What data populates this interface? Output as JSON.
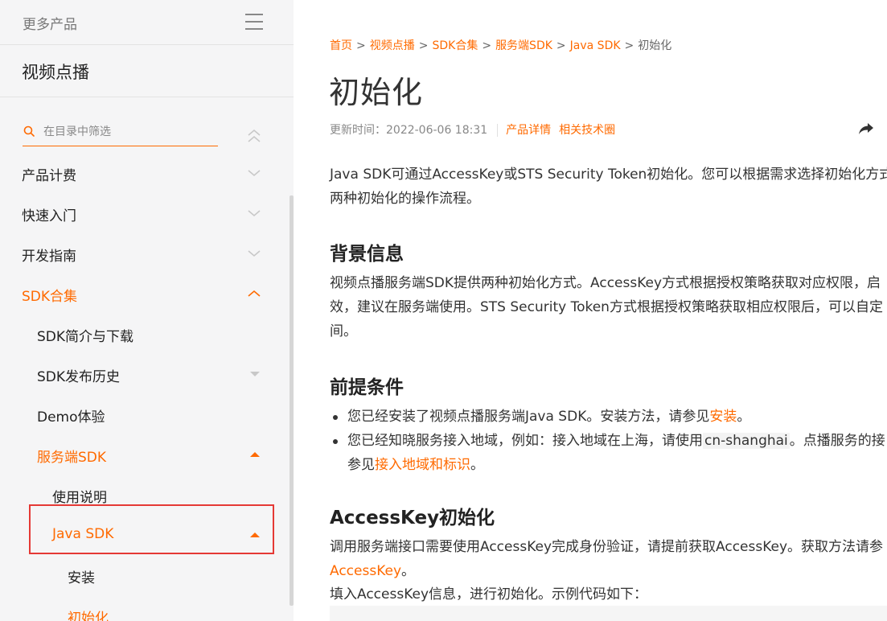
{
  "sidebar": {
    "more_products": "更多产品",
    "product_title": "视频点播",
    "filter_placeholder": "在目录中筛选",
    "items": [
      {
        "label": "产品计费"
      },
      {
        "label": "快速入门"
      },
      {
        "label": "开发指南"
      },
      {
        "label": "SDK合集"
      },
      {
        "label": "SDK简介与下载"
      },
      {
        "label": "SDK发布历史"
      },
      {
        "label": "Demo体验"
      },
      {
        "label": "服务端SDK"
      },
      {
        "label": "使用说明"
      },
      {
        "label": "Java SDK"
      },
      {
        "label": "安装"
      },
      {
        "label": "初始化"
      }
    ]
  },
  "breadcrumb": {
    "items": [
      "首页",
      "视频点播",
      "SDK合集",
      "服务端SDK",
      "Java SDK",
      "初始化"
    ],
    "sep": ">"
  },
  "article": {
    "title": "初始化",
    "updated": "更新时间：2022-06-06 18:31",
    "product_detail": "产品详情",
    "tech_circle": "相关技术圈",
    "intro_line1": "Java SDK可通过AccessKey或STS Security Token初始化。您可以根据需求选择初始化方式",
    "intro_line2": "两种初始化的操作流程。",
    "bg_heading": "背景信息",
    "bg_line1": "视频点播服务端SDK提供两种初始化方式。AccessKey方式根据授权策略获取对应权限，启",
    "bg_line2": "效，建议在服务端使用。STS Security Token方式根据授权策略获取相应权限后，可以自定",
    "bg_line3": "间。",
    "pre_heading": "前提条件",
    "pre1_text": "您已经安装了视频点播服务端Java SDK。安装方法，请参见",
    "pre1_link": "安装",
    "pre1_end": "。",
    "pre2_text": "您已经知晓服务接入地域，例如：接入地域在上海，请使用",
    "pre2_code": "cn-shanghai",
    "pre2_after": "。点播服务的接",
    "pre2_line2": "参见",
    "pre2_link": "接入地域和标识",
    "pre2_end": "。",
    "ak_heading": "AccessKey初始化",
    "ak_line1": "调用服务端接口需要使用AccessKey完成身份验证，请提前获取AccessKey。获取方法请参",
    "ak_link": "AccessKey",
    "ak_link_end": "。",
    "ak_line3": "填入AccessKey信息，进行初始化。示例代码如下："
  },
  "colors": {
    "accent": "#ff6a00",
    "highlight_border": "#e53935"
  }
}
